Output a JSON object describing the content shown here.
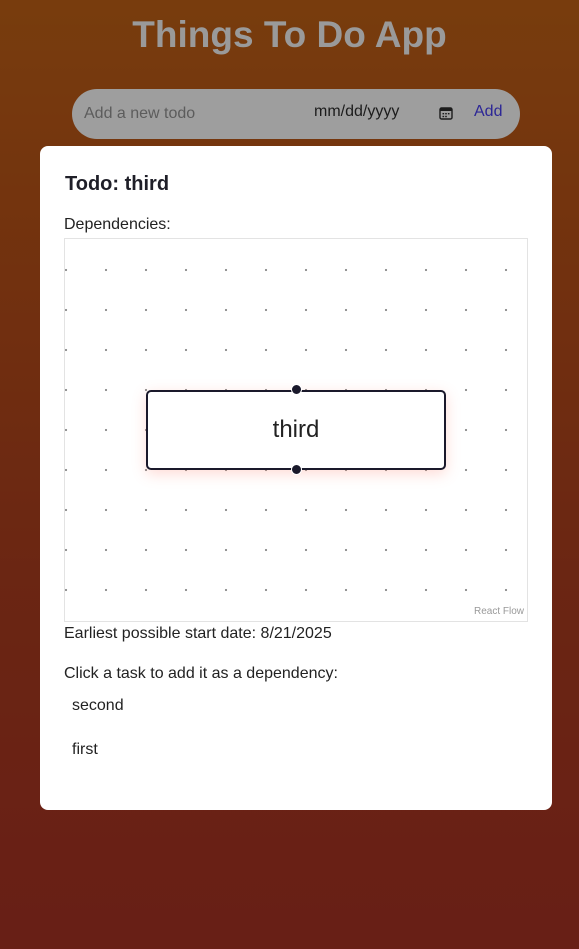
{
  "app": {
    "title": "Things To Do App"
  },
  "add_bar": {
    "placeholder": "Add a new todo",
    "date_placeholder": "mm/dd/yyyy",
    "add_label": "Add"
  },
  "modal": {
    "title": "Todo: third",
    "dependencies_label": "Dependencies:",
    "flow": {
      "node_label": "third",
      "attribution": "React Flow"
    },
    "start_date_text": "Earliest possible start date: 8/21/2025",
    "click_hint": "Click a task to add it as a dependency:",
    "tasks": [
      {
        "label": "second"
      },
      {
        "label": "first"
      }
    ]
  },
  "colors": {
    "background_top": "#c26216",
    "background_bottom": "#a93224",
    "link_blue": "#2c2696",
    "node_border": "#1a192b"
  },
  "icons": {
    "date_picker": "calendar-icon"
  }
}
